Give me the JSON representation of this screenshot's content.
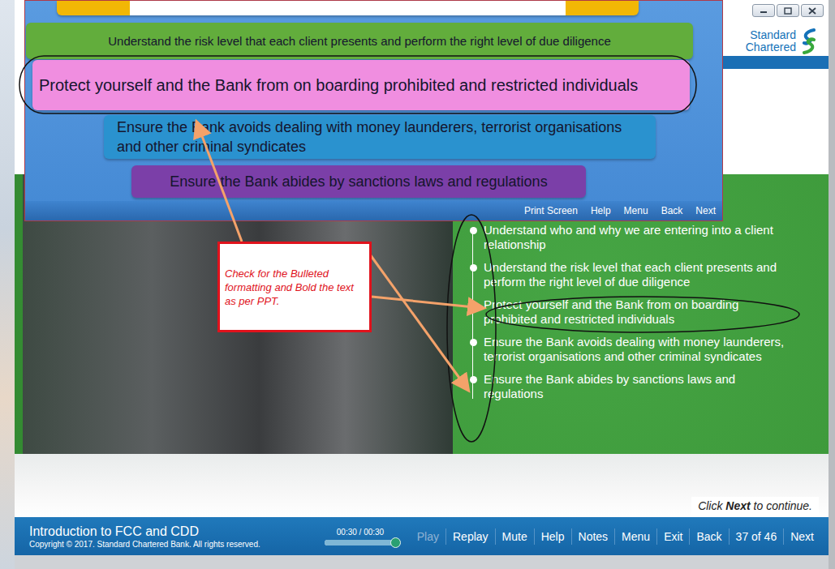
{
  "logo": {
    "line1": "Standard",
    "line2": "Chartered"
  },
  "slide": {
    "bars": [
      {
        "kind": "cut",
        "text": "",
        "color": "#f2b705"
      },
      {
        "kind": "text",
        "text": "Understand the risk level that each client presents and perform the right level of due diligence",
        "color": "#62ad3c"
      },
      {
        "kind": "text",
        "text": "Protect yourself and the Bank from on boarding prohibited and restricted individuals",
        "color": "#f08ee0"
      },
      {
        "kind": "text",
        "text": "Ensure the Bank avoids dealing with money launderers, terrorist organisations and other criminal syndicates",
        "color": "#2a92cf"
      },
      {
        "kind": "text",
        "text": "Ensure the Bank abides by sanctions laws and regulations",
        "color": "#7b3fa8"
      }
    ],
    "nav": [
      "Print Screen",
      "Help",
      "Menu",
      "Back",
      "Next"
    ]
  },
  "bullets": [
    "Understand who and why we are entering into a client relationship",
    "Understand the risk level that each client presents and perform the right level of due diligence",
    "Protect yourself and the Bank from on boarding prohibited and restricted individuals",
    "Ensure the Bank avoids dealing with money launderers, terrorist organisations and other criminal syndicates",
    "Ensure the Bank abides by sanctions laws and regulations"
  ],
  "hint": {
    "before": "Click ",
    "bold": "Next",
    "after": " to continue."
  },
  "review_note": "Check for the Bulleted formatting and Bold the text as per PPT.",
  "player_bar": {
    "title": "Introduction to FCC and CDD",
    "copyright": "Copyright © 2017. Standard Chartered Bank. All rights reserved.",
    "time": "00:30 / 00:30",
    "level": 1,
    "controls": [
      {
        "kind": "button",
        "label": "Play",
        "disabled": true
      },
      {
        "kind": "button",
        "label": "Replay",
        "disabled": false
      },
      {
        "kind": "button",
        "label": "Mute",
        "disabled": false
      },
      {
        "kind": "button",
        "label": "Help",
        "disabled": false
      },
      {
        "kind": "button",
        "label": "Notes",
        "disabled": false
      },
      {
        "kind": "button",
        "label": "Menu",
        "disabled": false
      },
      {
        "kind": "button",
        "label": "Exit",
        "disabled": false
      },
      {
        "kind": "button",
        "label": "Back",
        "disabled": false
      },
      {
        "kind": "counter",
        "label": "37 of 46",
        "disabled": false
      },
      {
        "kind": "button",
        "label": "Next",
        "disabled": false
      }
    ]
  }
}
